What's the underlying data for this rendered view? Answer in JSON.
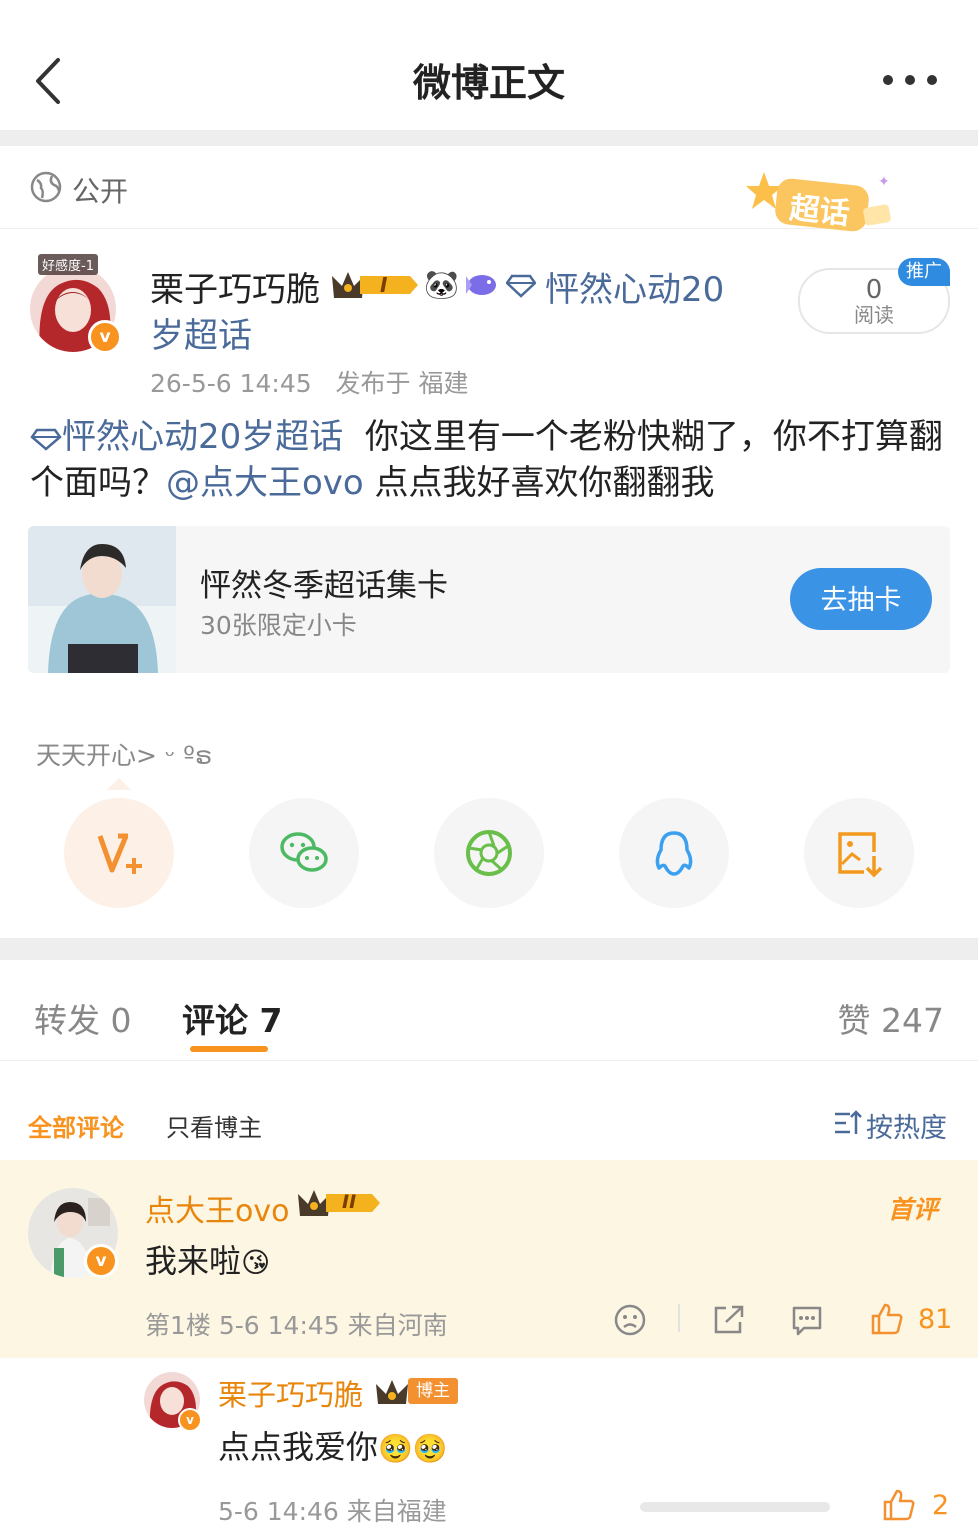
{
  "nav": {
    "title": "微博正文"
  },
  "visibility": {
    "label": "公开",
    "chaohua_badge": "超话"
  },
  "author": {
    "avatar_caption": "好感度-1",
    "name": "栗子巧巧脆",
    "level_badge": "I",
    "topic_part1": "怦然心动20",
    "topic_part2": "岁超话",
    "time": "26-5-6 14:45",
    "location": "发布于 福建",
    "read_count": "0",
    "read_label": "阅读",
    "promo_label": "推广"
  },
  "post": {
    "topic_link": "怦然心动20岁超话",
    "text_part1": "你这里有一个老粉快糊了，你不打算翻个面吗？",
    "mention": "@点大王ovo",
    "text_part2": "点点我好喜欢你翻翻我"
  },
  "card": {
    "title": "怦然冬季超话集卡",
    "subtitle": "30张限定小卡",
    "button": "去抽卡"
  },
  "mood_text": "天天开心> ᵕ ºຣ",
  "share_icons": [
    "v-plus-icon",
    "wechat-icon",
    "moments-icon",
    "qq-icon",
    "save-image-icon"
  ],
  "tabs": {
    "repost_label": "转发",
    "repost_count": "0",
    "comment_label": "评论",
    "comment_count": "7",
    "like_label": "赞",
    "like_count": "247"
  },
  "filters": {
    "all": "全部评论",
    "author_only": "只看博主",
    "sort": "按热度"
  },
  "comments": [
    {
      "name": "点大王ovo",
      "level_badge": "II",
      "text": "我来啦",
      "floor": "第1楼",
      "time": "5-6 14:45",
      "location": "来自河南",
      "likes": "81",
      "tag": "首评"
    },
    {
      "name": "栗子巧巧脆",
      "author_badge": "博主",
      "text": "点点我爱你",
      "time": "5-6 14:46",
      "location": "来自福建",
      "likes": "2"
    }
  ],
  "colors": {
    "accent": "#f7931e",
    "link": "#4a6a9a",
    "button": "#3a93e4",
    "highlight_bg": "#fdf6e3"
  }
}
